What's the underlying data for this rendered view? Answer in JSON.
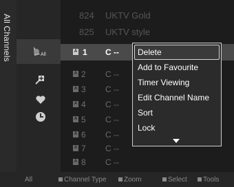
{
  "sidebar": {
    "title": "All Channels"
  },
  "icons": {
    "all_label": "All",
    "all": "satellite-all-icon",
    "added": "plus-pin-icon",
    "favourite": "heart-icon",
    "timer": "clock-icon"
  },
  "channels": [
    {
      "number": "824",
      "name": "UKTV Gold"
    },
    {
      "number": "825",
      "name": "UKTV style"
    },
    {
      "number": "1",
      "name": "C --",
      "badge": "A"
    },
    {
      "number": "2",
      "name": "C --",
      "badge": "A"
    },
    {
      "number": "3",
      "name": "C --",
      "badge": "A"
    },
    {
      "number": "4",
      "name": "C --",
      "badge": "A"
    },
    {
      "number": "5",
      "name": "C --",
      "badge": "A"
    },
    {
      "number": "6",
      "name": "C --",
      "badge": "A"
    },
    {
      "number": "7",
      "name": "C --",
      "badge": "A"
    },
    {
      "number": "8",
      "name": "C --",
      "badge": "A"
    }
  ],
  "menu": {
    "items": [
      "Delete",
      "Add to Favourite",
      "Timer Viewing",
      "Edit Channel Name",
      "Sort",
      "Lock"
    ],
    "selected": "Delete"
  },
  "footer": {
    "all": "All",
    "channel_type": "Channel Type",
    "zoom": "Zoom",
    "select": "Select",
    "tools": "Tools"
  },
  "colors": {
    "background": "#1c1c1c",
    "highlight": "#4a4a4a",
    "text": "#ffffff"
  }
}
